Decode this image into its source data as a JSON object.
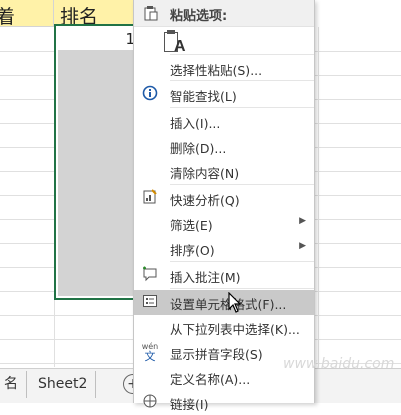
{
  "sheet": {
    "header_left_text": "着",
    "header_right_text": "排名",
    "cell_value": "1"
  },
  "tabs": {
    "left_fragment": "名",
    "sheet2": "Sheet2",
    "add_symbol": "+"
  },
  "menu": {
    "header": "粘贴选项:",
    "paste_letter": "A",
    "items": [
      {
        "label": "选择性粘贴(S)...",
        "icon": ""
      },
      {
        "label": "智能查找(L)",
        "icon": "smart-lookup-icon"
      },
      {
        "label": "插入(I)...",
        "icon": ""
      },
      {
        "label": "删除(D)...",
        "icon": ""
      },
      {
        "label": "清除内容(N)",
        "icon": ""
      },
      {
        "label": "快速分析(Q)",
        "icon": "quick-analysis-icon"
      },
      {
        "label": "筛选(E)",
        "icon": ""
      },
      {
        "label": "排序(O)",
        "icon": ""
      },
      {
        "label": "插入批注(M)",
        "icon": "insert-comment-icon"
      },
      {
        "label": "设置单元格格式(F)...",
        "icon": "format-cells-icon"
      },
      {
        "label": "从下拉列表中选择(K)...",
        "icon": ""
      },
      {
        "label": "显示拼音字段(S)",
        "icon": "phonetic-icon"
      },
      {
        "label": "定义名称(A)...",
        "icon": ""
      },
      {
        "label": "链接(I)",
        "icon": "link-icon"
      }
    ],
    "phonetic_glyph": "wén",
    "phonetic_char": "文",
    "submenu_arrow": "▶"
  },
  "watermark": "www.baidu.com"
}
